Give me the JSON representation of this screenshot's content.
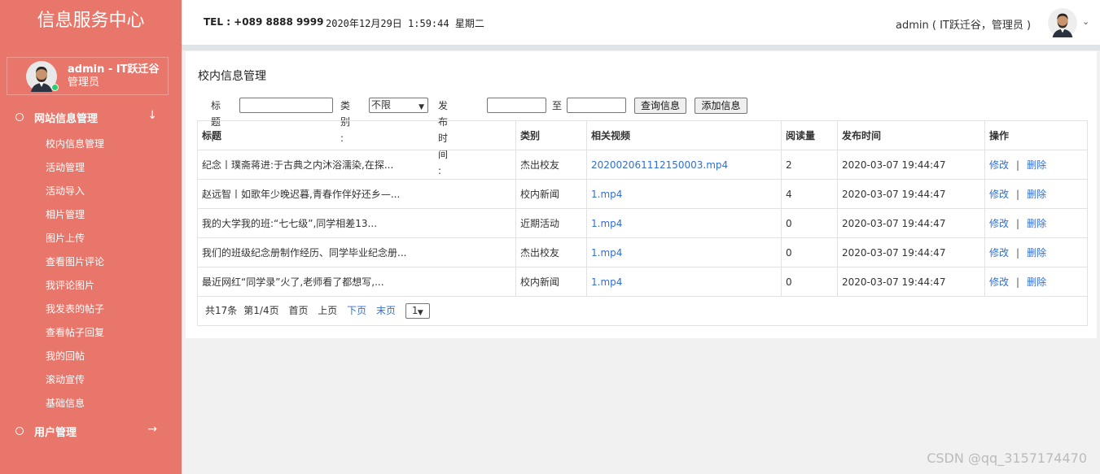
{
  "sidebar": {
    "brand": "信息服务中心",
    "user": {
      "name": "admin - IT跃迁谷",
      "role": "管理员"
    },
    "groups": [
      {
        "label": "网站信息管理",
        "arrow": "↓"
      },
      {
        "label": "用户管理",
        "arrow": "→"
      }
    ],
    "items": [
      "校内信息管理",
      "活动管理",
      "活动导入",
      "相片管理",
      "图片上传",
      "查看图片评论",
      "我评论图片",
      "我发表的帖子",
      "查看帖子回复",
      "我的回帖",
      "滚动宣传",
      "基础信息"
    ]
  },
  "header": {
    "tel": "TEL : +089 8888 9999",
    "datetime": "2020年12月29日 1:59:44 星期二",
    "user": "admin ( IT跃迁谷，管理员 )",
    "caret": "⌄"
  },
  "main": {
    "title": "校内信息管理",
    "filters": {
      "title_label": "标题 :",
      "category_label": "类别 :",
      "category_value": "不限",
      "date_label": "发布时间 :",
      "to_label": "至",
      "query_button": "查询信息",
      "add_button": "添加信息"
    },
    "table": {
      "columns": [
        "标题",
        "类别",
        "相关视频",
        "阅读量",
        "发布时间",
        "操作"
      ],
      "rows": [
        {
          "title": "纪念丨璞斋蒋进:于古典之内沐浴濡染,在探...",
          "category": "杰出校友",
          "video": "202002061112150003.mp4",
          "reads": "2",
          "date": "2020-03-07 19:44:47"
        },
        {
          "title": "赵远智丨如歌年少晚迟暮,青春作伴好还乡—...",
          "category": "校内新闻",
          "video": "1.mp4",
          "reads": "4",
          "date": "2020-03-07 19:44:47"
        },
        {
          "title": "我的大学我的班:“七七级”,同学相差13...",
          "category": "近期活动",
          "video": "1.mp4",
          "reads": "0",
          "date": "2020-03-07 19:44:47"
        },
        {
          "title": "我们的班级纪念册制作经历、同学毕业纪念册...",
          "category": "杰出校友",
          "video": "1.mp4",
          "reads": "0",
          "date": "2020-03-07 19:44:47"
        },
        {
          "title": "最近网红“同学录”火了,老师看了都想写,...",
          "category": "校内新闻",
          "video": "1.mp4",
          "reads": "0",
          "date": "2020-03-07 19:44:47"
        }
      ],
      "actions": {
        "edit": "修改",
        "sep": "|",
        "delete": "删除"
      }
    },
    "pager": {
      "total": "共17条",
      "page_info": "第1/4页",
      "first": "首页",
      "prev": "上页",
      "next": "下页",
      "last": "末页",
      "select_value": "1"
    }
  },
  "watermark": "CSDN @qq_3157174470",
  "colors": {
    "sidebar": "#e9766a",
    "link": "#2f6fd6",
    "online": "#2ecc71"
  }
}
